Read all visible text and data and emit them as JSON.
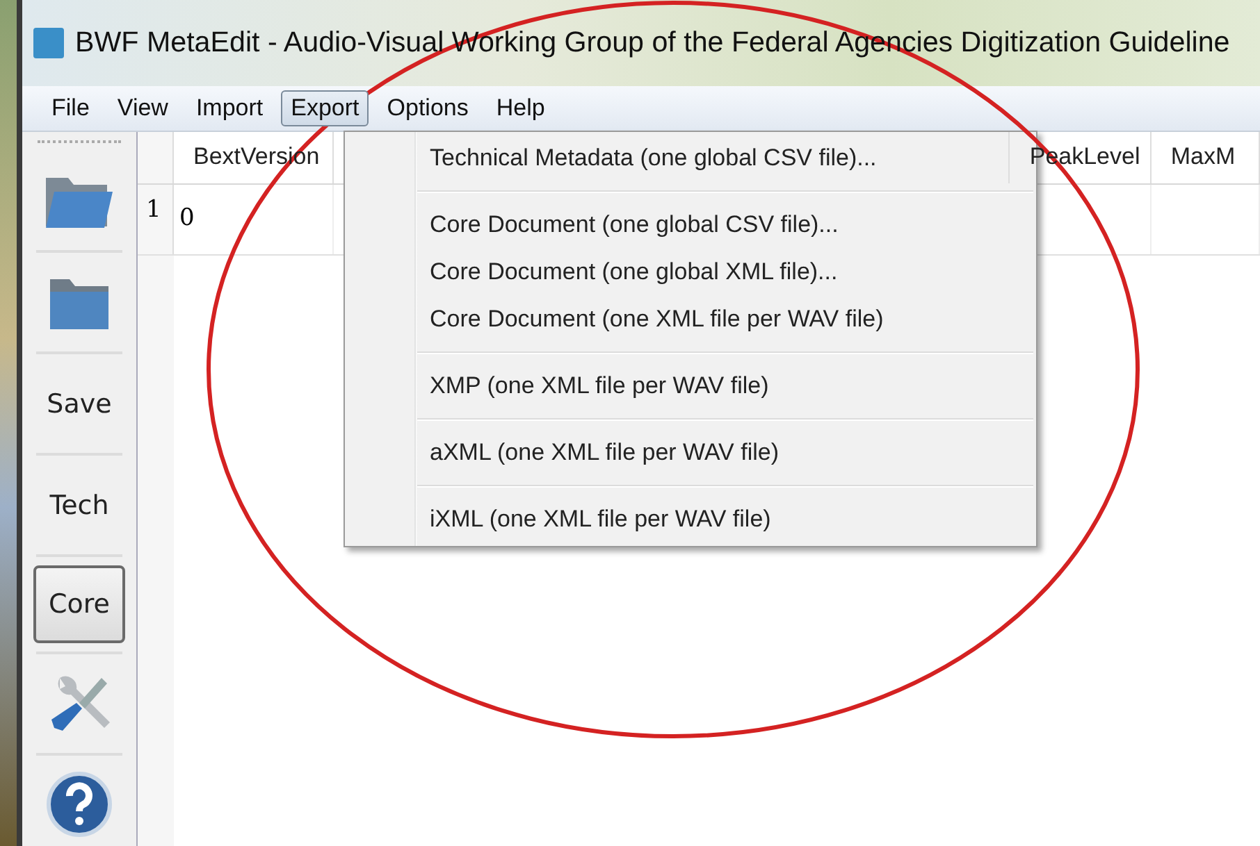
{
  "window": {
    "title": "BWF MetaEdit - Audio-Visual Working Group of the Federal Agencies Digitization Guideline"
  },
  "menu_bar": [
    {
      "label": "File",
      "selected": false
    },
    {
      "label": "View",
      "selected": false
    },
    {
      "label": "Import",
      "selected": false
    },
    {
      "label": "Export",
      "selected": true
    },
    {
      "label": "Options",
      "selected": false
    },
    {
      "label": "Help",
      "selected": false
    }
  ],
  "toolbar": [
    {
      "kind": "open-folder",
      "selected": false
    },
    {
      "kind": "folder",
      "selected": false
    },
    {
      "kind": "text",
      "label": "Save",
      "selected": false
    },
    {
      "kind": "text",
      "label": "Tech",
      "selected": false
    },
    {
      "kind": "text",
      "label": "Core",
      "selected": true
    },
    {
      "kind": "tools",
      "selected": false
    },
    {
      "kind": "help",
      "selected": false
    }
  ],
  "table": {
    "columns": [
      "BextVersion",
      "",
      "PeakLevel",
      "MaxM"
    ],
    "rows": [
      {
        "number": "1",
        "cells": [
          "0",
          "",
          "",
          ""
        ]
      }
    ]
  },
  "export_menu": {
    "groups": [
      [
        "Technical Metadata (one global CSV file)..."
      ],
      [
        "Core Document (one global CSV file)...",
        "Core Document (one global XML file)...",
        "Core Document (one XML file per WAV file)"
      ],
      [
        "XMP (one XML file per WAV file)"
      ],
      [
        "aXML (one XML file per WAV file)"
      ],
      [
        "iXML (one XML file per WAV file)"
      ]
    ]
  }
}
